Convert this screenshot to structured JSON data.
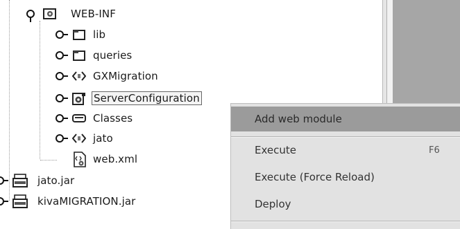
{
  "tree": {
    "nodes": [
      {
        "label": "WEB-INF",
        "icon": "webinf-folder-icon"
      },
      {
        "label": "lib",
        "icon": "folder-icon"
      },
      {
        "label": "queries",
        "icon": "folder-icon"
      },
      {
        "label": "GXMigration",
        "icon": "package-icon"
      },
      {
        "label": "ServerConfiguration",
        "icon": "config-icon"
      },
      {
        "label": "Classes",
        "icon": "classes-icon"
      },
      {
        "label": "jato",
        "icon": "package-icon"
      },
      {
        "label": "web.xml",
        "icon": "xml-file-icon"
      },
      {
        "label": "jato.jar",
        "icon": "jar-icon"
      },
      {
        "label": "kivaMIGRATION.jar",
        "icon": "jar-icon"
      }
    ]
  },
  "context_menu": {
    "items": [
      {
        "label": "Add web module",
        "shortcut": ""
      },
      {
        "label": "Execute",
        "shortcut": "F6"
      },
      {
        "label": "Execute (Force Reload)",
        "shortcut": ""
      },
      {
        "label": "Deploy",
        "shortcut": ""
      }
    ]
  },
  "colors": {
    "menu_background": "#e2e2e2",
    "menu_highlight": "#9b9b9b",
    "right_pane": "#a6a6a6"
  }
}
